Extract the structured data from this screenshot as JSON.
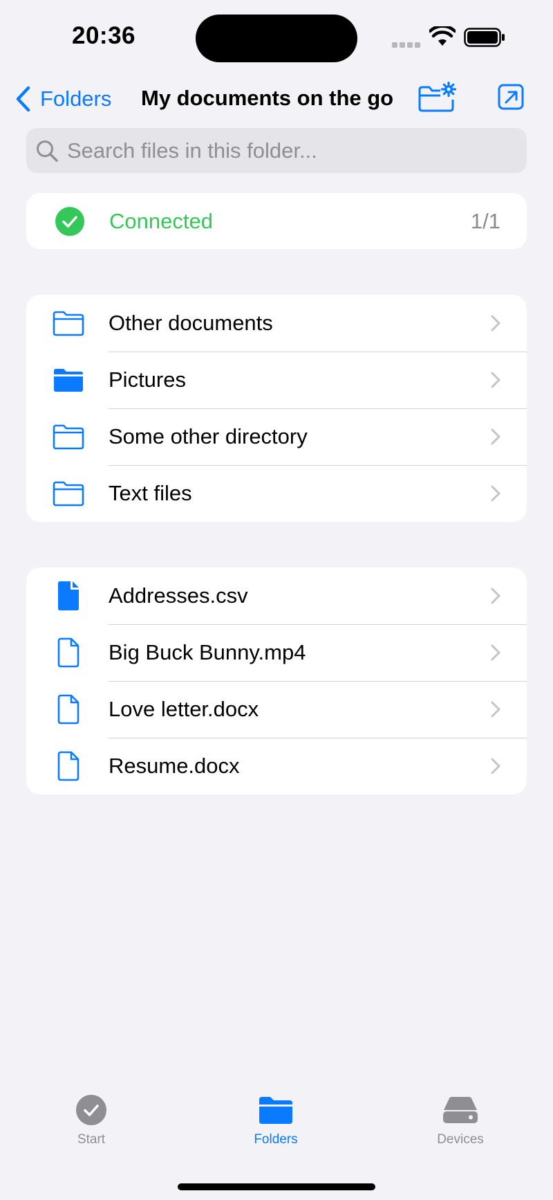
{
  "status_bar": {
    "time": "20:36"
  },
  "nav": {
    "back_label": "Folders",
    "title": "My documents on the go"
  },
  "search": {
    "placeholder": "Search files in this folder..."
  },
  "connection": {
    "label": "Connected",
    "count": "1/1"
  },
  "folders": [
    {
      "name": "Other documents",
      "icon": "folder-outline-icon"
    },
    {
      "name": "Pictures",
      "icon": "folder-filled-icon"
    },
    {
      "name": "Some other directory",
      "icon": "folder-outline-icon"
    },
    {
      "name": "Text files",
      "icon": "folder-outline-icon"
    }
  ],
  "files": [
    {
      "name": "Addresses.csv",
      "icon": "document-filled-icon"
    },
    {
      "name": "Big Buck Bunny.mp4",
      "icon": "document-outline-icon"
    },
    {
      "name": "Love letter.docx",
      "icon": "document-outline-icon"
    },
    {
      "name": "Resume.docx",
      "icon": "document-outline-icon"
    }
  ],
  "tabs": [
    {
      "label": "Start",
      "icon": "checkmark-circle-icon"
    },
    {
      "label": "Folders",
      "icon": "folder-filled-icon"
    },
    {
      "label": "Devices",
      "icon": "drive-icon"
    }
  ],
  "colors": {
    "accent": "#0a7aff",
    "success": "#34c759",
    "background": "#f2f2f7",
    "inactive_tab": "#8e8e93"
  }
}
